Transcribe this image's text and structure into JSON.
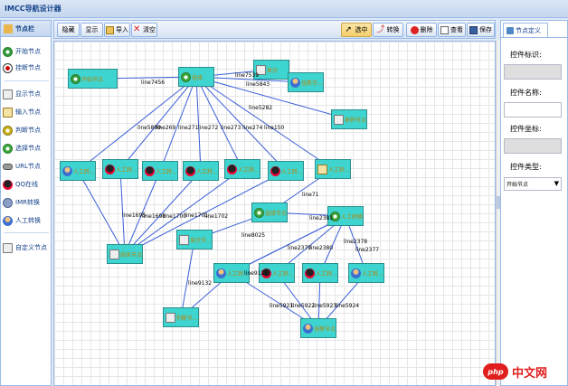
{
  "app": {
    "title": "IMCC导航设计器"
  },
  "left_panel": {
    "title": "节点栏",
    "items": [
      {
        "label": "开始节点",
        "icon": "start-node-icon"
      },
      {
        "label": "挂断节点",
        "icon": "hangup-node-icon"
      },
      {
        "label": "显示节点",
        "icon": "display-node-icon"
      },
      {
        "label": "输入节点",
        "icon": "input-node-icon"
      },
      {
        "label": "判断节点",
        "icon": "judge-node-icon"
      },
      {
        "label": "选择节点",
        "icon": "select-node-icon"
      },
      {
        "label": "URL节点",
        "icon": "url-node-icon"
      },
      {
        "label": "QQ在线",
        "icon": "qq-online-icon"
      },
      {
        "label": "IMR转换",
        "icon": "imr-convert-icon"
      },
      {
        "label": "人工转换",
        "icon": "manual-transfer-icon"
      },
      {
        "label": "自定义节点",
        "icon": "custom-node-icon"
      }
    ]
  },
  "toolbar": {
    "left": [
      {
        "label": "隐藏",
        "icon": ""
      },
      {
        "label": "显示",
        "icon": ""
      },
      {
        "label": "导入",
        "icon": "import-icon"
      },
      {
        "label": "清空",
        "icon": "clear-icon"
      }
    ],
    "right": [
      {
        "label": "选中",
        "icon": "pointer-icon"
      },
      {
        "label": "转换",
        "icon": "transform-icon"
      },
      {
        "label": "删除",
        "icon": "delete-icon"
      },
      {
        "label": "查看",
        "icon": "view-icon"
      },
      {
        "label": "保存",
        "icon": "save-icon"
      }
    ]
  },
  "canvas": {
    "nodes": [
      {
        "id": "n0",
        "label": "开始节点",
        "kind": "start"
      },
      {
        "id": "n1",
        "label": "选择",
        "kind": "select"
      },
      {
        "id": "n2",
        "label": "显示",
        "kind": "display"
      },
      {
        "id": "n3",
        "label": "挂断节...",
        "kind": "hangup"
      },
      {
        "id": "n4",
        "label": "再转节点",
        "kind": "display"
      },
      {
        "id": "n5",
        "label": "人工转...",
        "kind": "manual"
      },
      {
        "id": "n6",
        "label": "人工转...",
        "kind": "qq"
      },
      {
        "id": "n7",
        "label": "人工转...",
        "kind": "qq"
      },
      {
        "id": "n8",
        "label": "人工转...",
        "kind": "qq"
      },
      {
        "id": "n9",
        "label": "人工转...",
        "kind": "qq"
      },
      {
        "id": "n10",
        "label": "人工转...",
        "kind": "qq"
      },
      {
        "id": "n11",
        "label": "人工转...",
        "kind": "input"
      },
      {
        "id": "n12",
        "label": "结束节点",
        "kind": "display"
      },
      {
        "id": "n13",
        "label": "选择节点",
        "kind": "select"
      },
      {
        "id": "n14",
        "label": "显示节...",
        "kind": "display"
      },
      {
        "id": "n15",
        "label": "人工转换",
        "kind": "select"
      },
      {
        "id": "n16",
        "label": "人工转...",
        "kind": "manual"
      },
      {
        "id": "n17",
        "label": "人工转...",
        "kind": "qq"
      },
      {
        "id": "n18",
        "label": "人工转...",
        "kind": "qq"
      },
      {
        "id": "n19",
        "label": "人工转...",
        "kind": "manual"
      },
      {
        "id": "n20",
        "label": "判断节...",
        "kind": "display"
      },
      {
        "id": "n21",
        "label": "挂断节点",
        "kind": "hangup"
      }
    ],
    "edges": [
      {
        "from": "n0",
        "to": "n1",
        "label": "line7456"
      },
      {
        "from": "n1",
        "to": "n2",
        "label": "line7539"
      },
      {
        "from": "n1",
        "to": "n3",
        "label": "line5843"
      },
      {
        "from": "n1",
        "to": "n4",
        "label": "line5282"
      },
      {
        "from": "n1",
        "to": "n5",
        "label": "line5899"
      },
      {
        "from": "n1",
        "to": "n6",
        "label": "line269"
      },
      {
        "from": "n1",
        "to": "n7",
        "label": "line271"
      },
      {
        "from": "n1",
        "to": "n8",
        "label": "line272"
      },
      {
        "from": "n1",
        "to": "n9",
        "label": "line273"
      },
      {
        "from": "n1",
        "to": "n10",
        "label": "line274"
      },
      {
        "from": "n1",
        "to": "n11",
        "label": "line150"
      },
      {
        "from": "n5",
        "to": "n12",
        "label": "line1695"
      },
      {
        "from": "n6",
        "to": "n12",
        "label": "line1698"
      },
      {
        "from": "n7",
        "to": "n12",
        "label": "line1700"
      },
      {
        "from": "n8",
        "to": "n12",
        "label": "line1701"
      },
      {
        "from": "n9",
        "to": "n12",
        "label": "line1702"
      },
      {
        "from": "n10",
        "to": "n12",
        "label": ""
      },
      {
        "from": "n11",
        "to": "n13",
        "label": "line71"
      },
      {
        "from": "n13",
        "to": "n15",
        "label": "line2381"
      },
      {
        "from": "n13",
        "to": "n14",
        "label": "line8025"
      },
      {
        "from": "n15",
        "to": "n17",
        "label": "line2379"
      },
      {
        "from": "n15",
        "to": "n18",
        "label": "line2380"
      },
      {
        "from": "n15",
        "to": "n19",
        "label": "line2377"
      },
      {
        "from": "n15",
        "to": "n16",
        "label": "line2378"
      },
      {
        "from": "n16",
        "to": "n20",
        "label": "line9132"
      },
      {
        "from": "n20",
        "to": "n14",
        "label": ""
      },
      {
        "from": "n15",
        "to": "n16",
        "label": "line9125"
      },
      {
        "from": "n16",
        "to": "n21",
        "label": "line5921"
      },
      {
        "from": "n17",
        "to": "n21",
        "label": "line5922"
      },
      {
        "from": "n18",
        "to": "n21",
        "label": "line5923"
      },
      {
        "from": "n19",
        "to": "n21",
        "label": "line5924"
      }
    ]
  },
  "right_panel": {
    "tab": "节点定义",
    "fields": [
      {
        "label": "控件标识:",
        "value": "",
        "disabled": true
      },
      {
        "label": "控件名称:",
        "value": "",
        "disabled": false
      },
      {
        "label": "控件坐标:",
        "value": "",
        "disabled": true
      }
    ],
    "type_label": "控件类型:",
    "type_value": "开始节点"
  },
  "watermark": {
    "logo": "php",
    "text": "中文网"
  },
  "colors": {
    "node_fill": "#3ed4d0",
    "edge": "#3a5fd9",
    "accent": "#15428b"
  }
}
